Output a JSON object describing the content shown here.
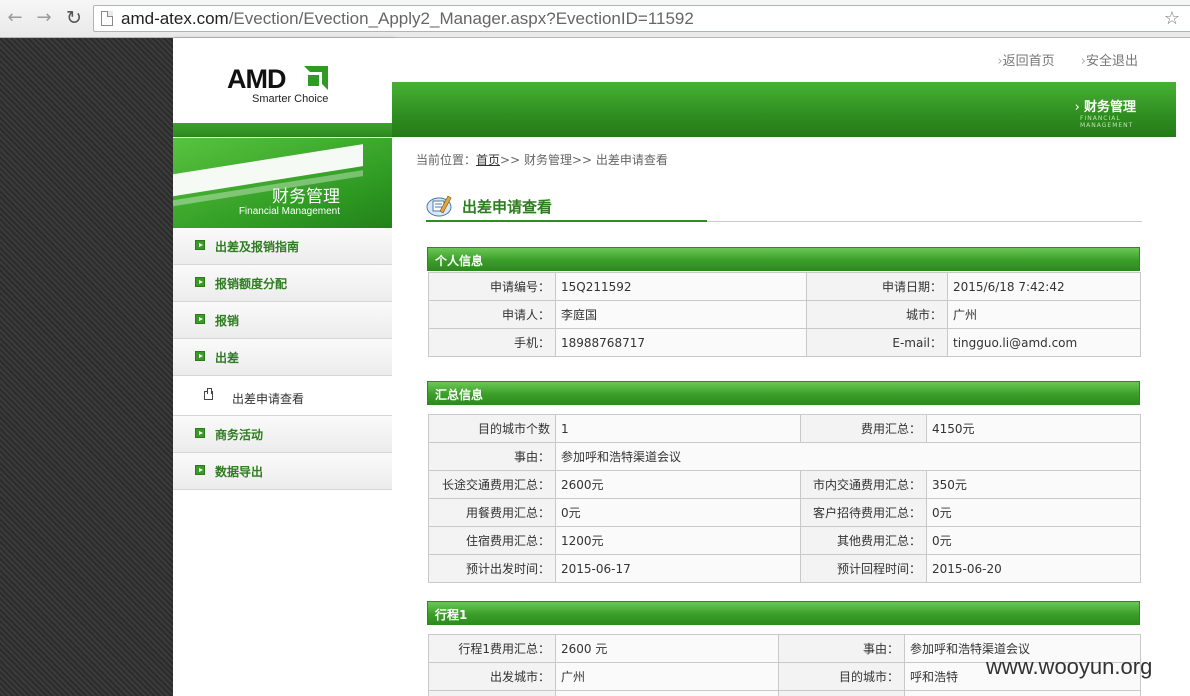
{
  "browser": {
    "url_host": "amd-atex.com",
    "url_path": "/Evection/Evection_Apply2_Manager.aspx?EvectionID=11592"
  },
  "header": {
    "logo_text": "AMD",
    "tagline": "Smarter Choice",
    "links": [
      "返回首页",
      "安全退出"
    ],
    "banner_title": "财务管理",
    "banner_sub": "FINANCIAL MANAGEMENT"
  },
  "sidebar": {
    "title": "财务管理",
    "subtitle": "Financial Management",
    "items": [
      {
        "label": "出差及报销指南"
      },
      {
        "label": "报销额度分配"
      },
      {
        "label": "报销"
      },
      {
        "label": "出差"
      },
      {
        "label": "出差申请查看"
      },
      {
        "label": "商务活动"
      },
      {
        "label": "数据导出"
      }
    ]
  },
  "breadcrumb": {
    "prefix": "当前位置：",
    "home": "首页",
    "rest": ">> 财务管理>> 出差申请查看"
  },
  "page_title": "出差申请查看",
  "personal": {
    "title": "个人信息",
    "rows": [
      [
        "申请编号：",
        "15Q211592",
        "申请日期：",
        "2015/6/18 7:42:42"
      ],
      [
        "申请人：",
        "李庭国",
        "城市：",
        "广州"
      ],
      [
        "手机：",
        "18988768717",
        "E-mail：",
        "tingguo.li@amd.com"
      ]
    ]
  },
  "summary": {
    "title": "汇总信息",
    "rows": [
      [
        "目的城市个数",
        "1",
        "费用汇总：",
        "4150元"
      ],
      [
        "事由：",
        "参加呼和浩特渠道会议"
      ],
      [
        "长途交通费用汇总：",
        "2600元",
        "市内交通费用汇总：",
        "350元"
      ],
      [
        "用餐费用汇总：",
        "0元",
        "客户招待费用汇总：",
        "0元"
      ],
      [
        "住宿费用汇总：",
        "1200元",
        "其他费用汇总：",
        "0元"
      ],
      [
        "预计出发时间：",
        "2015-06-17",
        "预计回程时间：",
        "2015-06-20"
      ]
    ]
  },
  "trip": {
    "title": "行程1",
    "rows": [
      [
        "行程1费用汇总：",
        "2600 元",
        "事由：",
        "参加呼和浩特渠道会议"
      ],
      [
        "出发城市：",
        "广州",
        "目的城市：",
        "呼和浩特"
      ],
      [
        "",
        "",
        "",
        ""
      ]
    ]
  },
  "watermark": "www.wooyun.org"
}
